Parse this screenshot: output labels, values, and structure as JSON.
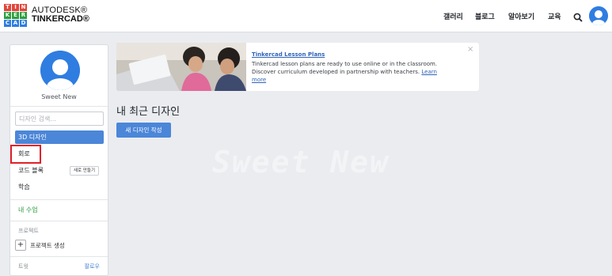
{
  "header": {
    "logo_letters": [
      "T",
      "I",
      "N",
      "K",
      "E",
      "R",
      "C",
      "A",
      "D"
    ],
    "logo_colors": [
      "#e2443a",
      "#e2443a",
      "#e2443a",
      "#2e9e3e",
      "#2e9e3e",
      "#2e9e3e",
      "#2f7de1",
      "#2f7de1",
      "#2f7de1"
    ],
    "brand_line1": "AUTODESK®",
    "brand_line2": "TINKERCAD®",
    "nav": [
      {
        "label": "갤러리"
      },
      {
        "label": "블로그"
      },
      {
        "label": "알아보기"
      },
      {
        "label": "교육"
      }
    ],
    "search_icon": "search-icon",
    "avatar_icon": "user-avatar-icon"
  },
  "sidebar": {
    "username": "Sweet New",
    "search_placeholder": "디자인 검색...",
    "items": [
      {
        "label": "3D 디자인",
        "active": true
      },
      {
        "label": "회로",
        "active": false
      },
      {
        "label": "코드 블록",
        "active": false,
        "badge": "새로 만들기"
      },
      {
        "label": "학습",
        "active": false
      }
    ],
    "classes_label": "내 수업",
    "projects_label": "프로젝트",
    "create_project_label": "프로젝트 생성",
    "follow_section_label": "트윗",
    "follow_link": "팔로우"
  },
  "banner": {
    "title": "Tinkercad Lesson Plans",
    "text": "Tinkercad lesson plans are ready to use online or in the classroom. Discover curriculum developed in partnership with teachers.",
    "link": "Learn more",
    "close": "×"
  },
  "main": {
    "title": "내 최근 디자인",
    "create_button": "새 디자인 작성",
    "watermark": "Sweet New"
  },
  "colors": {
    "accent": "#4b86d8",
    "highlight_box": "#e0202a",
    "classes_green": "#2e9e3e"
  }
}
